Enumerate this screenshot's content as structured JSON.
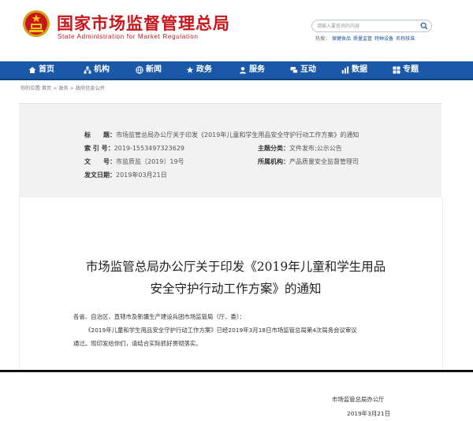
{
  "header": {
    "title_cn": "国家市场监督管理总局",
    "title_en": "State Administration for Market Regulation",
    "search_placeholder": "请输入要查询的内容",
    "hot_label": "热搜：",
    "hot_links": [
      "保健食品",
      "质量监管",
      "特种设备",
      "名称核准"
    ]
  },
  "nav": {
    "items": [
      {
        "label": "首页",
        "icon": "home-icon"
      },
      {
        "label": "机构",
        "icon": "org-icon"
      },
      {
        "label": "新闻",
        "icon": "news-icon"
      },
      {
        "label": "政务",
        "icon": "gov-icon"
      },
      {
        "label": "服务",
        "icon": "service-icon"
      },
      {
        "label": "互动",
        "icon": "interact-icon"
      },
      {
        "label": "数据",
        "icon": "data-icon"
      },
      {
        "label": "专题",
        "icon": "topic-icon"
      }
    ]
  },
  "breadcrumb": "你的位置:首页 > 政务 > 政府信息公开",
  "info": {
    "title_label": "标　　题：",
    "title_value": "市场监管总局办公厅关于印发《2019年儿童和学生用品安全守护行动工作方案》的通知",
    "index_label": "索 引 号：",
    "index_value": "2019-1553497323629",
    "category_label": "主题分类：",
    "category_value": "文件发布;公示公告",
    "docno_label": "文　　号：",
    "docno_value": "市监质监〔2019〕19号",
    "org_label": "所属机构：",
    "org_value": "产品质量安全监督管理司",
    "date_label": "发文日期：",
    "date_value": "2019年03月21日"
  },
  "document": {
    "title_line1": "市场监管总局办公厅关于印发《2019年儿童和学生用品",
    "title_line2": "安全守护行动工作方案》的通知",
    "salutation": "各省、自治区、直辖市及新疆生产建设兵团市场监管局（厅、委）：",
    "body_line1": "《2019年儿童和学生用品安全守护行动工作方案》已经2019年3月18日市场监管总局第4次局务会议审议",
    "body_line2": "通过。现印发给你们，请结合实际抓好贯彻落实。",
    "signer": "市场监管总局办公厅",
    "sign_date": "2019年3月21日"
  },
  "colors": {
    "brand_red": "#c8161d",
    "nav_blue": "#1b59a8"
  }
}
